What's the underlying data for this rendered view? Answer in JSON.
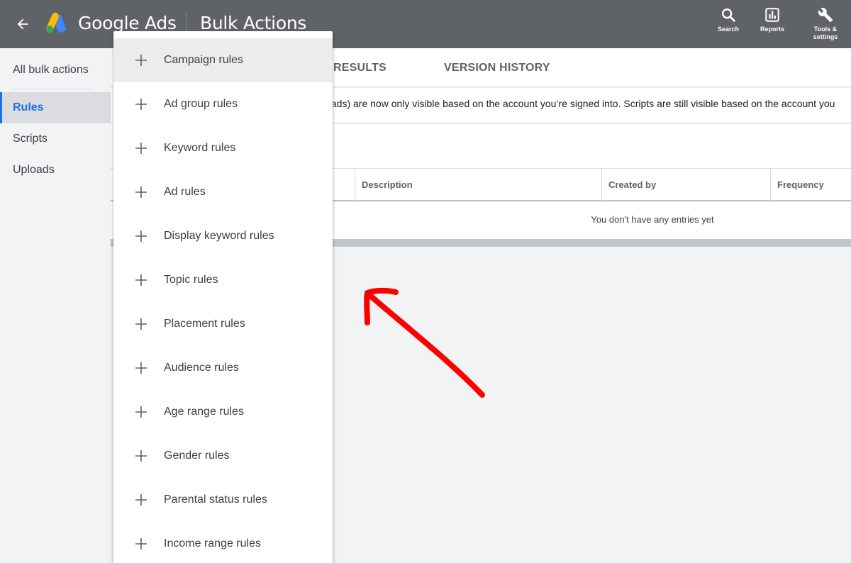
{
  "header": {
    "brand": "Google Ads",
    "title": "Bulk Actions",
    "actions": [
      {
        "icon": "search-icon",
        "label": "Search"
      },
      {
        "icon": "reports-icon",
        "label": "Reports"
      },
      {
        "icon": "wrench-icon",
        "label": "Tools & settings"
      }
    ]
  },
  "sidebar": {
    "all_label": "All bulk actions",
    "items": [
      {
        "label": "Rules",
        "active": true
      },
      {
        "label": "Scripts",
        "active": false
      },
      {
        "label": "Uploads",
        "active": false
      }
    ]
  },
  "tabs": [
    {
      "label": "RESULTS"
    },
    {
      "label": "VERSION HISTORY"
    }
  ],
  "notice_text": "loads) are now only visible based on the account you’re signed into. Scripts are still visible based on the account you",
  "table": {
    "columns": [
      "Description",
      "Created by",
      "Frequency"
    ],
    "empty_message": "You don't have any entries yet"
  },
  "menu": {
    "items": [
      {
        "label": "Campaign rules",
        "highlighted": true
      },
      {
        "label": "Ad group rules"
      },
      {
        "label": "Keyword rules"
      },
      {
        "label": "Ad rules"
      },
      {
        "label": "Display keyword rules"
      },
      {
        "label": "Topic rules"
      },
      {
        "label": "Placement rules"
      },
      {
        "label": "Audience rules"
      },
      {
        "label": "Age range rules"
      },
      {
        "label": "Gender rules"
      },
      {
        "label": "Parental status rules"
      },
      {
        "label": "Income range rules"
      }
    ]
  },
  "annotation": {
    "shape": "red-arrow",
    "color": "#ff0000"
  },
  "colors": {
    "header_bg": "#5f6368",
    "accent": "#1a73e8",
    "page_bg": "#f1f3f4"
  }
}
